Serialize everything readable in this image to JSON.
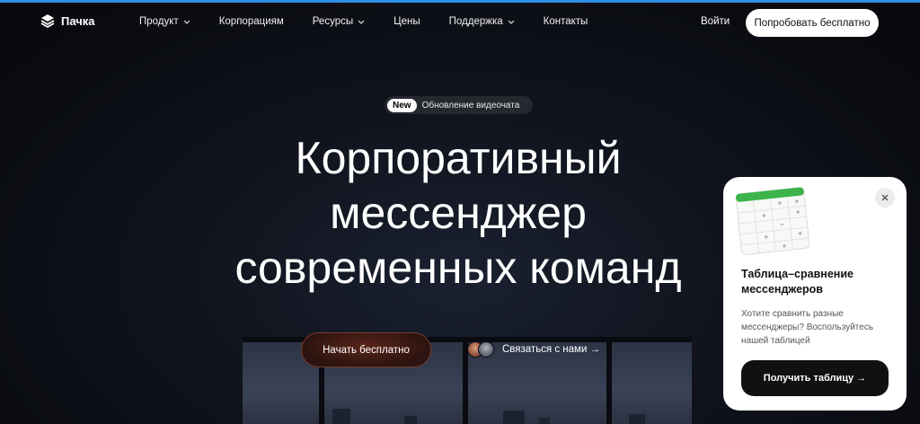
{
  "nav": {
    "logo_text": "Пачка",
    "items": [
      {
        "label": "Продукт",
        "has_dropdown": true
      },
      {
        "label": "Корпорациям",
        "has_dropdown": false
      },
      {
        "label": "Ресурсы",
        "has_dropdown": true
      },
      {
        "label": "Цены",
        "has_dropdown": false
      },
      {
        "label": "Поддержка",
        "has_dropdown": true
      },
      {
        "label": "Контакты",
        "has_dropdown": false
      }
    ],
    "login_label": "Войти",
    "try_label": "Попробовать бесплатно"
  },
  "badge": {
    "new_label": "New",
    "text": "Обновление видеочата"
  },
  "hero": {
    "line1": "Корпоративный",
    "line2": "мессенджер",
    "line3": "современных команд",
    "start_label": "Начать бесплатно",
    "contact_label": "Связаться с нами →"
  },
  "popup": {
    "title": "Таблица–сравнение мессенджеров",
    "description": "Хотите сравнить разные мессенджеры? Воспользуйтесь нашей таблицей",
    "button_label": "Получить таблицу →"
  },
  "colors": {
    "accent_line": "#2e8fe6",
    "background": "#0b0d14",
    "cta_glow": "#5a2419",
    "sheet_header": "#3cb44a"
  }
}
